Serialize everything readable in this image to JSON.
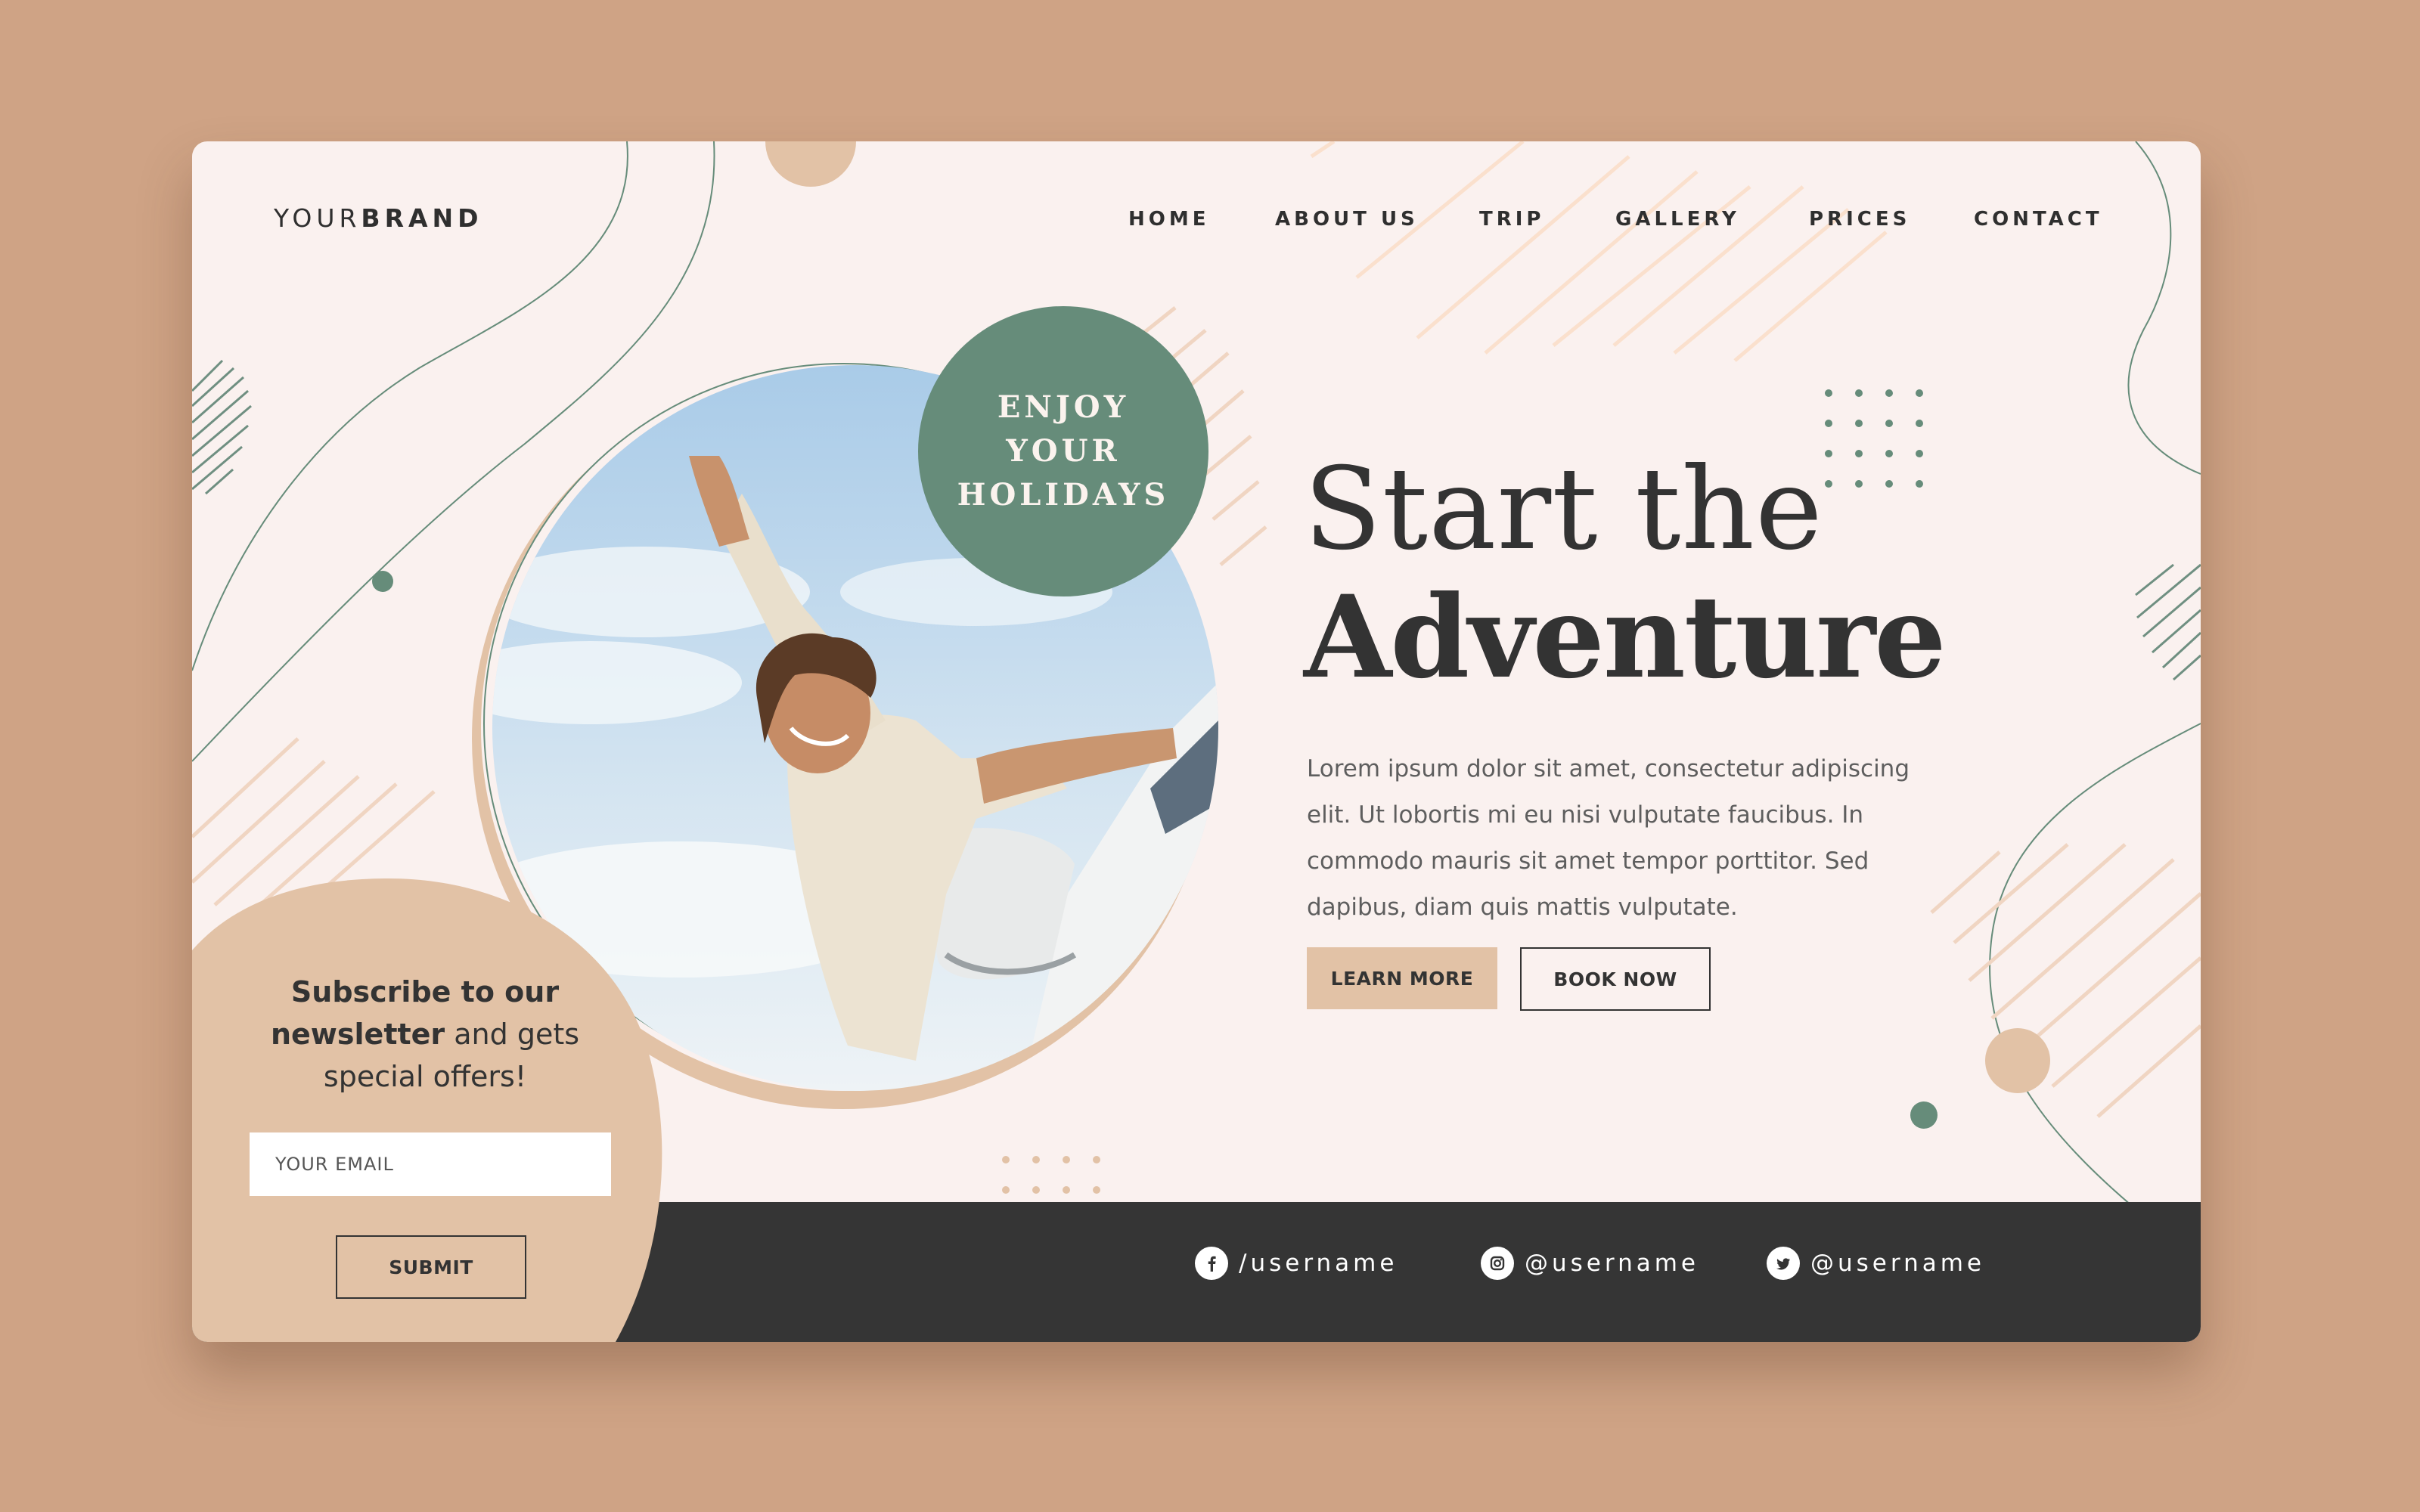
{
  "brand": {
    "part1": "YOUR",
    "part2": "BRAND"
  },
  "nav": [
    {
      "label": "HOME"
    },
    {
      "label": "ABOUT US"
    },
    {
      "label": "TRIP"
    },
    {
      "label": "GALLERY"
    },
    {
      "label": "PRICES"
    },
    {
      "label": "CONTACT"
    }
  ],
  "badge": {
    "line1": "ENJOY",
    "line2": "YOUR",
    "line3": "HOLIDAYS"
  },
  "hero": {
    "title_line1": "Start the",
    "title_line2": "Adventure",
    "body": "Lorem ipsum dolor sit amet, consectetur adipiscing elit. Ut lobortis mi eu nisi vulputate faucibus. In commodo mauris sit amet tempor porttitor. Sed dapibus, diam quis mattis vulputate.",
    "learn_more": "LEARN MORE",
    "book_now": "BOOK NOW"
  },
  "newsletter": {
    "bold1": "Subscribe to our",
    "bold2": "newsletter",
    "rest": " and gets",
    "line3": "special offers!",
    "email_placeholder": "YOUR EMAIL",
    "submit": "SUBMIT"
  },
  "social": [
    {
      "icon": "facebook-icon",
      "handle": "/username"
    },
    {
      "icon": "instagram-icon",
      "handle": "@username"
    },
    {
      "icon": "twitter-icon",
      "handle": "@username"
    }
  ],
  "colors": {
    "page_bg": "#cfa385",
    "card_bg": "#faf1ef",
    "accent_green": "#668c7a",
    "accent_beige": "#e2c2a6",
    "dark": "#333333"
  }
}
